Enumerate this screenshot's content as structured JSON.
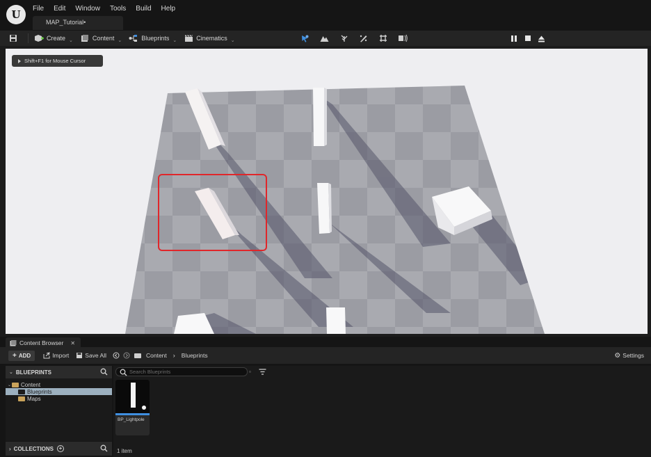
{
  "app": {
    "logo_text": "U",
    "menu": [
      "File",
      "Edit",
      "Window",
      "Tools",
      "Build",
      "Help"
    ],
    "map_tab": "MAP_Tutorial•"
  },
  "toolbar": {
    "create": "Create",
    "content": "Content",
    "blueprints": "Blueprints",
    "cinematics": "Cinematics"
  },
  "viewport": {
    "hint": "Shift+F1 for Mouse Cursor",
    "highlight_color": "#e0262a"
  },
  "content_browser": {
    "tab_label": "Content Browser",
    "add_label": "ADD",
    "import_label": "Import",
    "save_all_label": "Save All",
    "breadcrumb": [
      "Content",
      "Blueprints"
    ],
    "settings_label": "Settings",
    "section_title": "BLUEPRINTS",
    "tree": [
      {
        "label": "Content",
        "selected": false
      },
      {
        "label": "Blueprints",
        "selected": true
      },
      {
        "label": "Maps",
        "selected": false
      }
    ],
    "collections_label": "COLLECTIONS",
    "search_placeholder": "Search Blueprints",
    "assets": [
      {
        "name": "BP_Lightpole"
      }
    ],
    "item_count": "1 item"
  }
}
